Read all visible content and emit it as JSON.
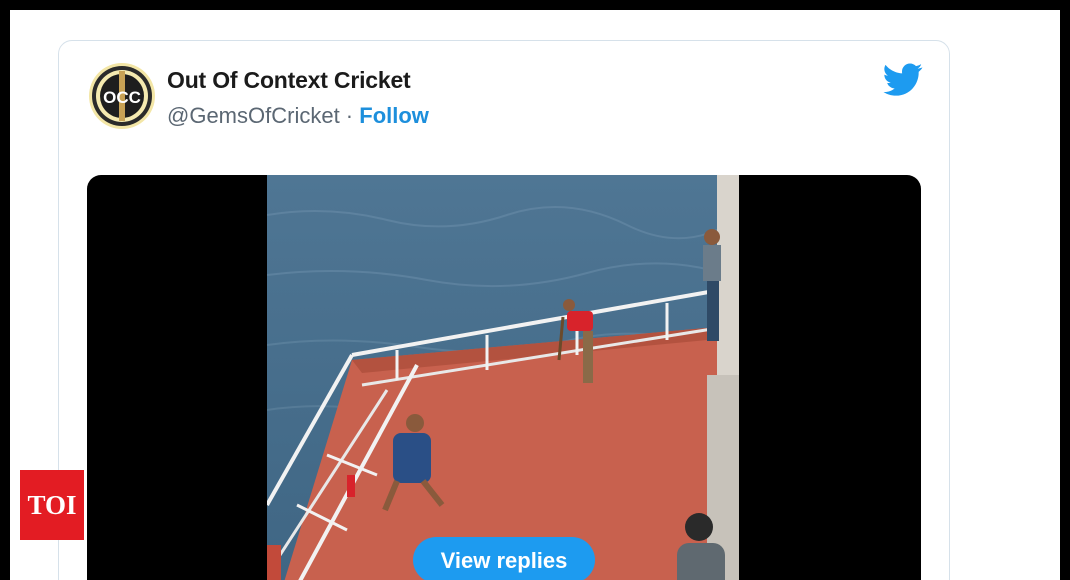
{
  "tweet": {
    "author_name": "Out Of Context Cricket",
    "handle": "@GemsOfCricket",
    "separator": " · ",
    "follow_label": "Follow",
    "avatar_text": "OCC"
  },
  "media": {
    "view_replies_label": "View replies"
  },
  "watermark": {
    "logo_text": "TOI"
  },
  "colors": {
    "accent": "#1d9bf0",
    "link": "#1d8fdc",
    "toi_red": "#e31c23"
  },
  "icons": [
    "twitter-bird-icon"
  ]
}
